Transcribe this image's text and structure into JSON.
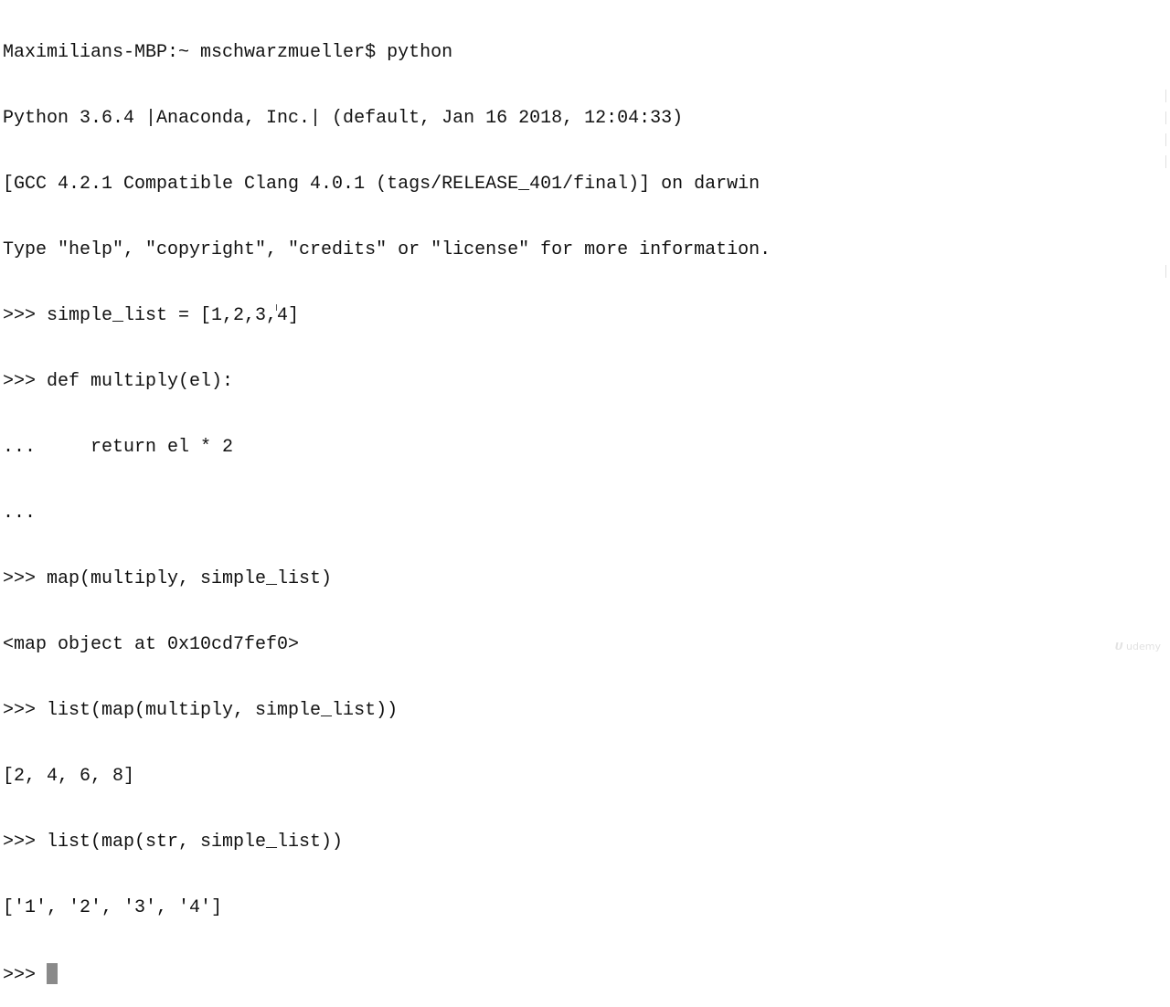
{
  "terminal": {
    "lines": [
      "Maximilians-MBP:~ mschwarzmueller$ python",
      "Python 3.6.4 |Anaconda, Inc.| (default, Jan 16 2018, 12:04:33)",
      "[GCC 4.2.1 Compatible Clang 4.0.1 (tags/RELEASE_401/final)] on darwin",
      "Type \"help\", \"copyright\", \"credits\" or \"license\" for more information.",
      ">>> simple_list = [1,2,3,4]",
      ">>> def multiply(el):",
      "...     return el * 2",
      "...",
      ">>> map(multiply, simple_list)",
      "<map object at 0x10cd7fef0>",
      ">>> list(map(multiply, simple_list))",
      "[2, 4, 6, 8]",
      ">>> list(map(str, simple_list))",
      "['1', '2', '3', '4']"
    ],
    "prompt": ">>> "
  },
  "watermark": "udemy",
  "cursor_color": "#8a8a8a"
}
